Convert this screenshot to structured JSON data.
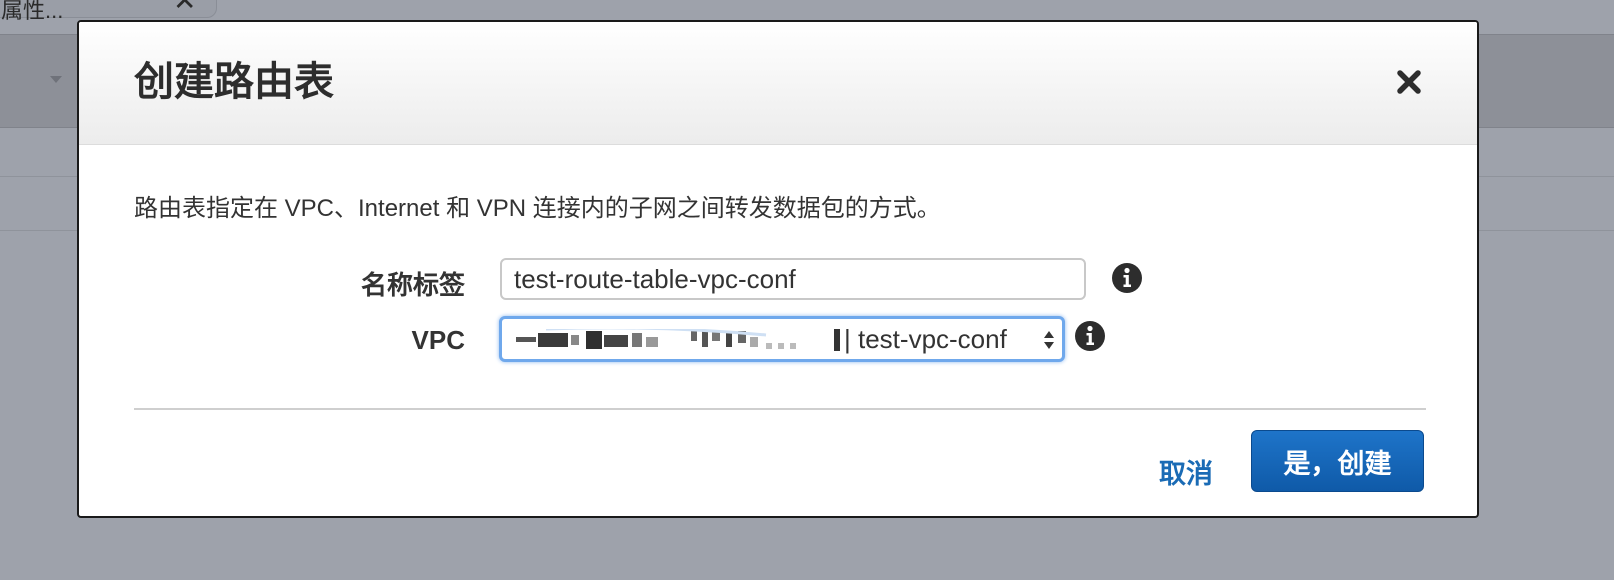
{
  "background": {
    "tab_label": "属性...",
    "tab_close_icon": "close-icon"
  },
  "dialog": {
    "title": "创建路由表",
    "close_icon": "close-icon",
    "description": "路由表指定在 VPC、Internet 和 VPN 连接内的子网之间转发数据包的方式。",
    "fields": {
      "name_tag": {
        "label": "名称标签",
        "value": "test-route-table-vpc-conf",
        "info_icon": "info-icon"
      },
      "vpc": {
        "label": "VPC",
        "selected_value": "test-vpc-conf",
        "separator": "|",
        "redacted": true,
        "info_icon": "info-icon"
      }
    },
    "buttons": {
      "cancel": "取消",
      "create": "是，创建"
    }
  },
  "colors": {
    "overlay": "#9ea2ab",
    "primary_button": "#1a6bb5",
    "link": "#1a6bb5",
    "focus_ring": "#6fa8ec"
  }
}
